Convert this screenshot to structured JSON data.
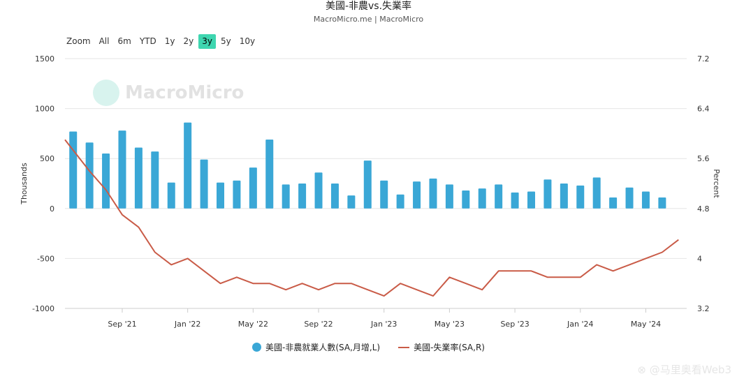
{
  "header": {
    "title": "美國-非農vs.失業率",
    "subtitle": "MacroMicro.me | MacroMicro"
  },
  "range_selector": {
    "buttons": [
      "Zoom",
      "All",
      "6m",
      "YTD",
      "1y",
      "2y",
      "3y",
      "5y",
      "10y"
    ],
    "active": "3y"
  },
  "watermark": {
    "logo_text": "MacroMicro",
    "footer_text": "⊗ @马里奥看Web3"
  },
  "colors": {
    "bars": "#3aa7d6",
    "line": "#c95b47",
    "active_button": "#3ed6b0",
    "grid": "#e6e6e6"
  },
  "chart_data": {
    "type": "bar+line",
    "x_tick_labels": [
      "Sep '21",
      "Jan '22",
      "May '22",
      "Sep '22",
      "Jan '23",
      "May '23",
      "Sep '23",
      "Jan '24",
      "May '24"
    ],
    "y_left": {
      "label": "Thousands",
      "ticks": [
        1500,
        1000,
        500,
        0,
        -500,
        -1000
      ],
      "range": [
        -1000,
        1500
      ]
    },
    "y_right": {
      "label": "Percent",
      "ticks": [
        "7.2",
        "6.4",
        "5.6",
        "4.8",
        "4",
        "3.2"
      ],
      "range": [
        3.2,
        7.2
      ]
    },
    "categories": [
      "2021-06",
      "2021-07",
      "2021-08",
      "2021-09",
      "2021-10",
      "2021-11",
      "2021-12",
      "2022-01",
      "2022-02",
      "2022-03",
      "2022-04",
      "2022-05",
      "2022-06",
      "2022-07",
      "2022-08",
      "2022-09",
      "2022-10",
      "2022-11",
      "2022-12",
      "2023-01",
      "2023-02",
      "2023-03",
      "2023-04",
      "2023-05",
      "2023-06",
      "2023-07",
      "2023-08",
      "2023-09",
      "2023-10",
      "2023-11",
      "2023-12",
      "2024-01",
      "2024-02",
      "2024-03",
      "2024-04",
      "2024-05",
      "2024-06",
      "2024-07"
    ],
    "series": [
      {
        "name": "美國-非農就業人數(SA,月增,L)",
        "type": "bar",
        "axis": "left",
        "values": [
          770,
          660,
          550,
          780,
          610,
          570,
          260,
          860,
          490,
          260,
          280,
          410,
          690,
          240,
          250,
          360,
          250,
          130,
          480,
          280,
          140,
          270,
          300,
          240,
          180,
          200,
          240,
          160,
          170,
          290,
          250,
          230,
          310,
          110,
          210,
          170,
          110
        ]
      },
      {
        "name": "美國-失業率(SA,R)",
        "type": "line",
        "axis": "right",
        "x_start_index": 0,
        "values": [
          5.9,
          5.4,
          5.1,
          4.7,
          4.5,
          4.1,
          3.9,
          4.0,
          3.8,
          3.6,
          3.7,
          3.6,
          3.6,
          3.5,
          3.6,
          3.5,
          3.6,
          3.6,
          3.5,
          3.4,
          3.6,
          3.5,
          3.4,
          3.7,
          3.6,
          3.5,
          3.8,
          3.8,
          3.8,
          3.7,
          3.7,
          3.7,
          3.9,
          3.8,
          3.9,
          4.0,
          4.1,
          4.3
        ]
      }
    ]
  }
}
